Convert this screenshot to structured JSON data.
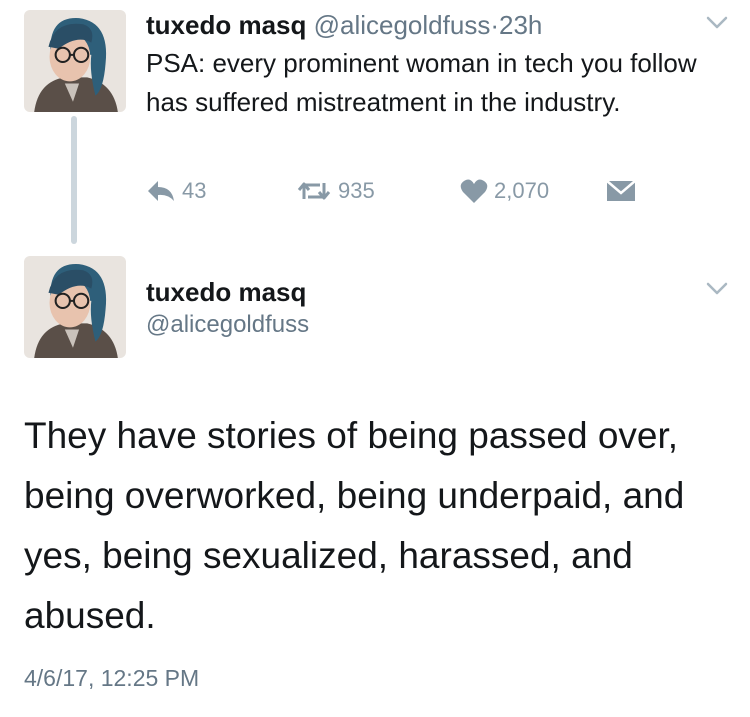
{
  "tweet1": {
    "name": "tuxedo masq",
    "handle": "@alicegoldfuss",
    "separator": "·",
    "time": "23h",
    "text": "PSA: every prominent woman in tech you follow has suffered mistreatment in the industry.",
    "actions": {
      "reply_count": "43",
      "retweet_count": "935",
      "like_count": "2,070"
    }
  },
  "tweet2": {
    "name": "tuxedo masq",
    "handle": "@alicegoldfuss",
    "text": "They have stories of being passed over, being overworked, being underpaid, and yes, being sexualized, harassed, and abused.",
    "timestamp": "4/6/17, 12:25 PM"
  },
  "icons": {
    "menu": "chevron-down-icon",
    "reply": "reply-icon",
    "retweet": "retweet-icon",
    "like": "heart-icon",
    "dm": "envelope-icon"
  },
  "colors": {
    "text": "#14171a",
    "secondary": "#657786",
    "action_gray": "#8899a6",
    "thread_line": "#ccd6dd"
  }
}
